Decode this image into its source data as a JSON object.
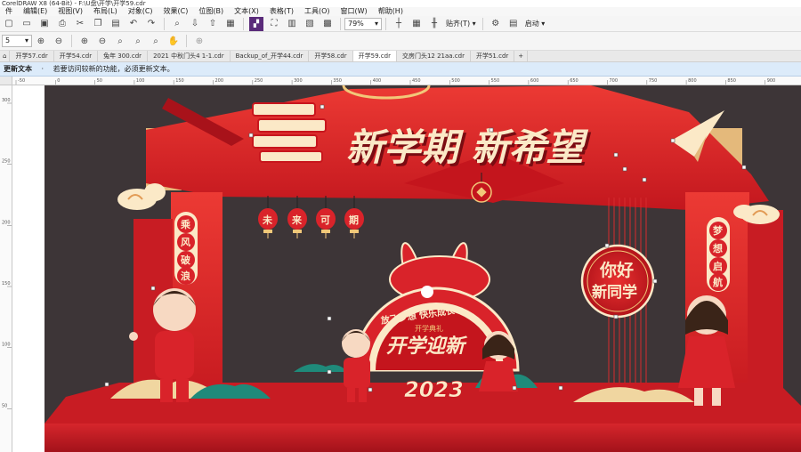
{
  "window": {
    "title": "CorelDRAW X8 (64-Bit) - F:\\U盘\\开学\\开学59.cdr"
  },
  "menu": [
    "件",
    "编辑(E)",
    "视图(V)",
    "布局(L)",
    "对象(C)",
    "效果(C)",
    "位图(B)",
    "文本(X)",
    "表格(T)",
    "工具(O)",
    "窗口(W)",
    "帮助(H)"
  ],
  "toolbar": {
    "zoom_value": "79%",
    "snap_label": "贴齐(T)",
    "launch_label": "启动"
  },
  "propbar": {
    "size_value": "5"
  },
  "tabs": [
    "开学57.cdr",
    "开学54.cdr",
    "兔年 300.cdr",
    "2021 中秋门头4 1-1.cdr",
    "Backup_of_开学44.cdr",
    "开学58.cdr",
    "开学59.cdr",
    "交房门头12 21aa.cdr",
    "开学51.cdr"
  ],
  "active_tab_index": 6,
  "infobar": {
    "title": "更新文本",
    "message": "若要访问较新的功能，必须更新文本。"
  },
  "rulers": {
    "h_labels": [
      "-50",
      "0",
      "50",
      "100",
      "150",
      "200",
      "250",
      "300",
      "350",
      "400",
      "450",
      "500",
      "550",
      "600",
      "650",
      "700",
      "750",
      "800",
      "850",
      "900"
    ],
    "v_labels": [
      "300",
      "250",
      "200",
      "150",
      "100",
      "50"
    ]
  },
  "artwork": {
    "main_title": "新学期 新希望",
    "lanterns": [
      "未",
      "来",
      "可",
      "期"
    ],
    "left_banner": [
      "乘",
      "风",
      "破",
      "浪"
    ],
    "right_banner": [
      "梦",
      "想",
      "启",
      "航"
    ],
    "round_sign_line1": "你好",
    "round_sign_line2": "新同学",
    "arch_slogan": "放飞梦想 快乐成长",
    "arch_small": "开学典礼",
    "arch_title": "开学迎新",
    "arch_year": "2023"
  },
  "colors": {
    "red": "#d9232a",
    "dark_red": "#b8151c",
    "gold": "#f2c879",
    "cream": "#fbe9c7",
    "wall": "#3d3537"
  }
}
